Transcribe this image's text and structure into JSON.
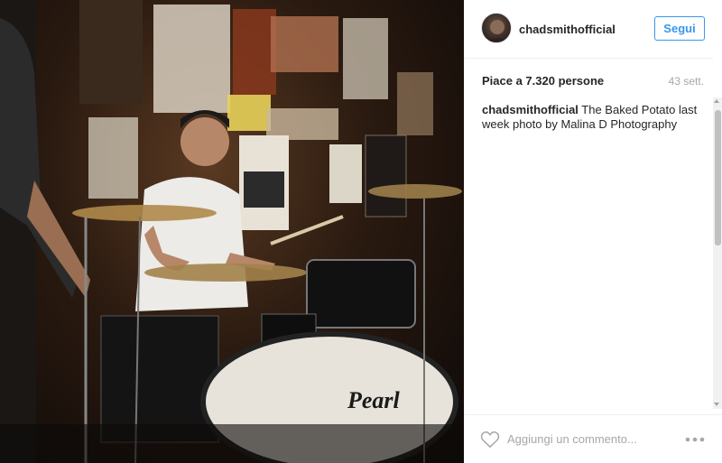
{
  "photo": {
    "alt_icon": "photo-image",
    "kick_drum_brand": "Pearl"
  },
  "header": {
    "username": "chadsmithofficial",
    "follow_label": "Segui"
  },
  "post": {
    "likes_text": "Piace a 7.320 persone",
    "time_ago": "43 sett.",
    "caption_user": "chadsmithofficial",
    "caption_text": " The Baked Potato last week photo by Malina D Photography"
  },
  "comment": {
    "placeholder": "Aggiungi un commento...",
    "heart_icon": "heart-icon",
    "more_icon": "more-options-icon"
  },
  "colors": {
    "link_blue": "#3897f0",
    "muted_gray": "#a5a7aa",
    "text": "#262626"
  }
}
